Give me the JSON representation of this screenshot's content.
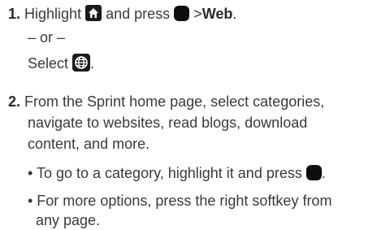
{
  "steps": [
    {
      "number": "1.",
      "text_before": "Highlight",
      "text_press": "and press",
      "gt": ">",
      "web_label": "Web",
      "period": ".",
      "or": "– or –",
      "select": "Select",
      "select_period": "."
    },
    {
      "number": "2.",
      "lines": [
        "From the Sprint home page, select categories,",
        "navigate to websites, read blogs, download",
        "content, and more."
      ],
      "bullets": [
        {
          "text": "• To go to a category, highlight it and press",
          "end": "."
        },
        {
          "lines": [
            "• For more options, press the right softkey from",
            "any page."
          ]
        }
      ]
    }
  ],
  "icons": {
    "home": "home-icon",
    "menu_key": "menu-key-icon",
    "web": "globe-icon"
  }
}
